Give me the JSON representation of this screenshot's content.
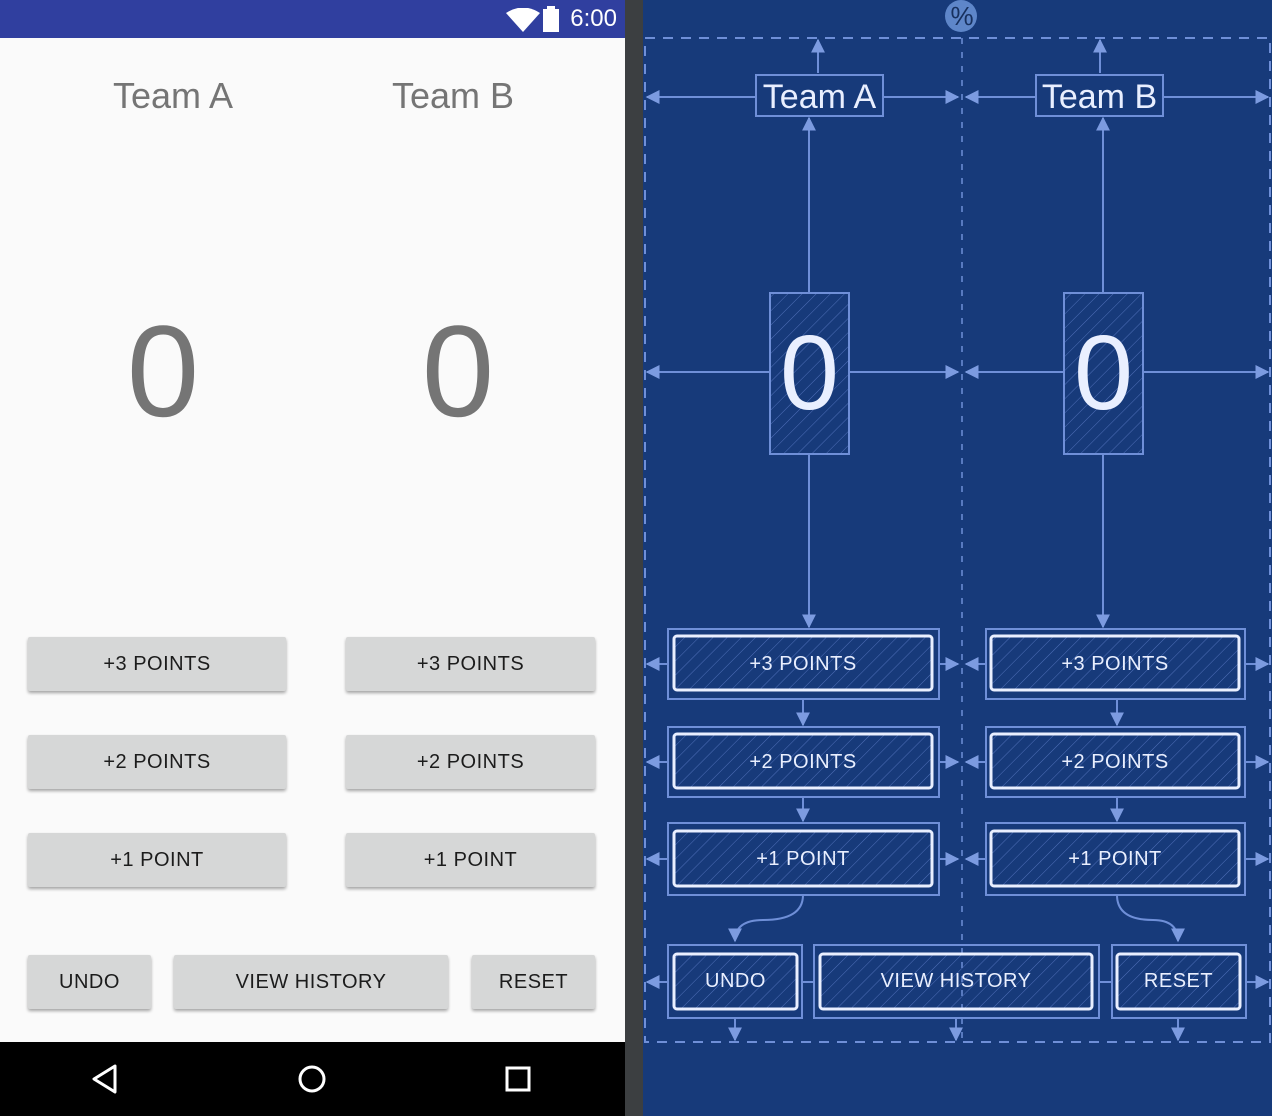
{
  "status_bar": {
    "time": "6:00"
  },
  "teams": [
    {
      "name": "Team A",
      "score": "0"
    },
    {
      "name": "Team B",
      "score": "0"
    }
  ],
  "buttons": {
    "plus3": "+3 POINTS",
    "plus2": "+2 POINTS",
    "plus1": "+1 POINT",
    "undo": "UNDO",
    "view_history": "VIEW HISTORY",
    "reset": "RESET"
  },
  "blueprint": {
    "percent_badge": "%"
  },
  "colors": {
    "status_bar": "#303f9f",
    "blueprint_bg": "#173a7a",
    "blueprint_line": "#6f8fd8",
    "button_bg": "#d6d7d7",
    "text_gray": "#757575"
  },
  "icons": [
    "wifi-icon",
    "battery-icon",
    "back-icon",
    "home-icon",
    "recents-icon"
  ]
}
